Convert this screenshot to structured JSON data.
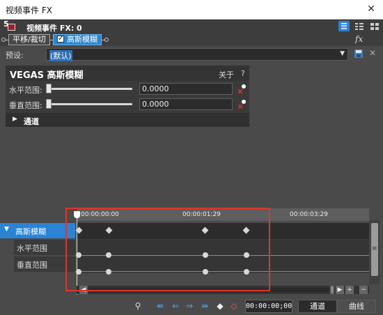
{
  "window": {
    "title": "视频事件 FX",
    "close_symbol": "✕"
  },
  "header": {
    "badge_number": "5",
    "fx_title": "视频事件 FX: 0",
    "fx_icon": "fx"
  },
  "chain": {
    "items": [
      {
        "label": "平移/裁切",
        "active": false,
        "checked": false
      },
      {
        "label": "高斯模糊",
        "active": true,
        "checked": true
      }
    ]
  },
  "preset": {
    "label": "预设:",
    "value": "(默认)"
  },
  "plugin": {
    "name": "VEGAS 高斯模糊",
    "about_label": "关于",
    "help_label": "?",
    "params": [
      {
        "label": "水平范围:",
        "value": "0.0000"
      },
      {
        "label": "垂直范围:",
        "value": "0.0000"
      }
    ],
    "channel_label": "通道"
  },
  "timeline": {
    "ruler_ticks": [
      "00:00:00:00",
      "00:00:01:29",
      "00:00:03:29"
    ],
    "tracks": [
      {
        "label": "高斯模糊",
        "selected": true,
        "marker": "diamond",
        "keyframes": [
          0.0,
          0.11,
          0.44,
          0.58
        ]
      },
      {
        "label": "水平范围",
        "selected": false,
        "marker": "circle",
        "keyframes": [
          0.0,
          0.11,
          0.44,
          0.58
        ]
      },
      {
        "label": "垂直范围",
        "selected": false,
        "marker": "circle",
        "keyframes": [
          0.0,
          0.11,
          0.44,
          0.58
        ]
      }
    ]
  },
  "bottom": {
    "time_value": "00:00:00;00",
    "mode_channel": "通道",
    "mode_curve": "曲线"
  },
  "colors": {
    "accent": "#2b83d6",
    "highlight_box": "#e0342c",
    "selected_plugin": "#2f86c9"
  }
}
